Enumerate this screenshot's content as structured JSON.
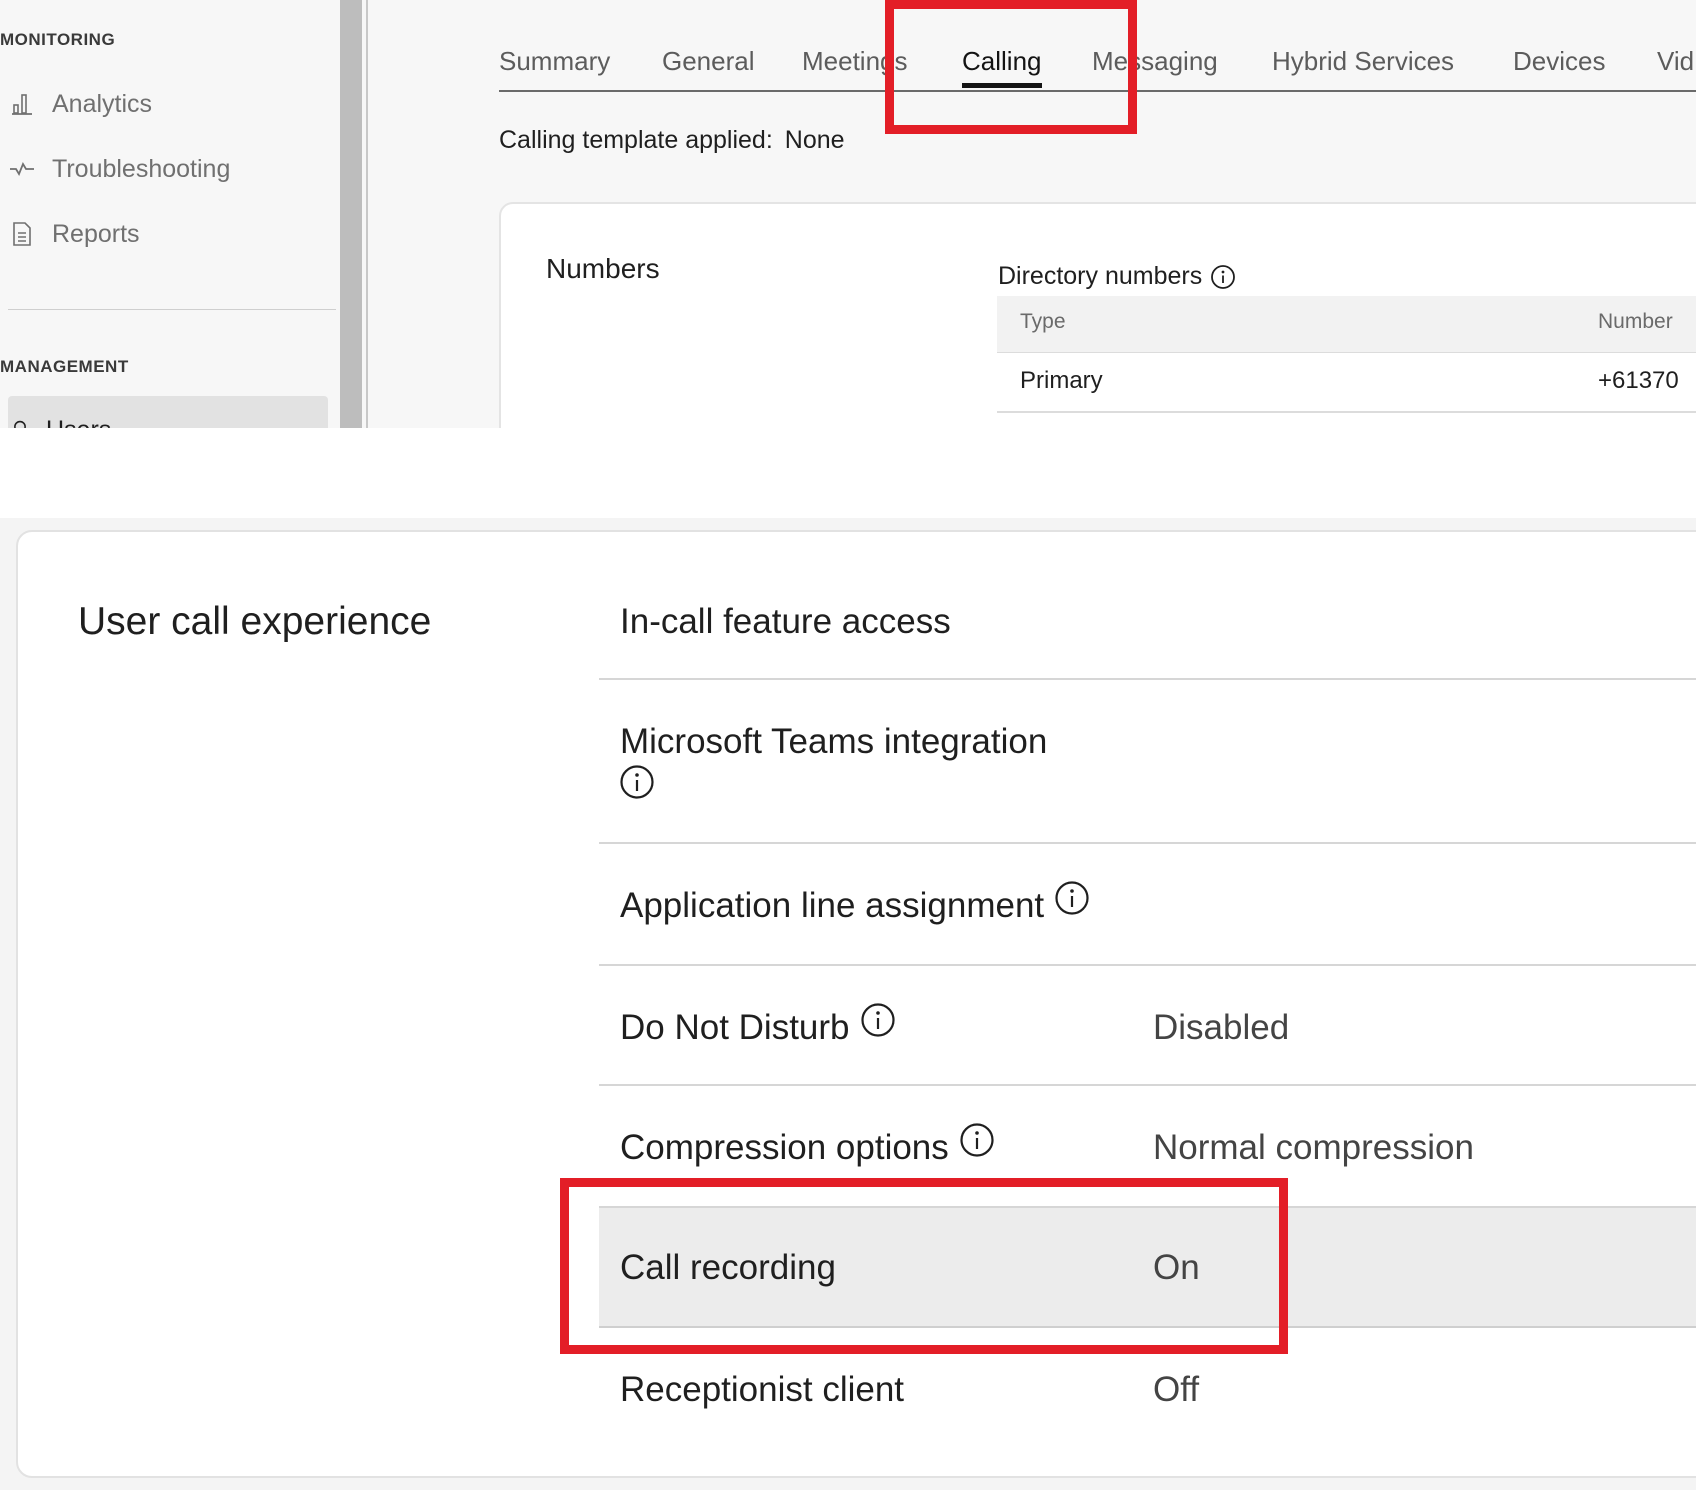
{
  "sidebar": {
    "monitoring_heading": "MONITORING",
    "monitoring_items": [
      {
        "label": "Analytics",
        "icon": "bar-chart-icon"
      },
      {
        "label": "Troubleshooting",
        "icon": "pulse-icon"
      },
      {
        "label": "Reports",
        "icon": "document-icon"
      }
    ],
    "management_heading": "MANAGEMENT",
    "selected_item": {
      "label": "Users",
      "icon": "user-icon"
    }
  },
  "tabs": [
    {
      "label": "Summary",
      "active": false
    },
    {
      "label": "General",
      "active": false
    },
    {
      "label": "Meetings",
      "active": false
    },
    {
      "label": "Calling",
      "active": true
    },
    {
      "label": "Messaging",
      "active": false
    },
    {
      "label": "Hybrid Services",
      "active": false
    },
    {
      "label": "Devices",
      "active": false
    },
    {
      "label": "Vid",
      "active": false
    }
  ],
  "calling_template": {
    "label": "Calling template applied:",
    "value": "None"
  },
  "numbers": {
    "title": "Numbers",
    "directory_label": "Directory numbers",
    "columns": [
      "Type",
      "Number"
    ],
    "rows": [
      [
        "Primary",
        "+61370"
      ]
    ]
  },
  "user_call_experience": {
    "title": "User call experience",
    "settings": [
      {
        "label": "In-call feature access",
        "value": ""
      },
      {
        "label": "Microsoft Teams integration",
        "value": ""
      },
      {
        "label": "Application line assignment",
        "value": ""
      },
      {
        "label": "Do Not Disturb",
        "value": "Disabled"
      },
      {
        "label": "Compression options",
        "value": "Normal compression"
      },
      {
        "label": "Call recording",
        "value": "On"
      },
      {
        "label": "Receptionist client",
        "value": "Off"
      }
    ]
  },
  "colors": {
    "highlight_box": "#e31e27",
    "active_tab": "#141414",
    "selected_row": "#ececec"
  }
}
